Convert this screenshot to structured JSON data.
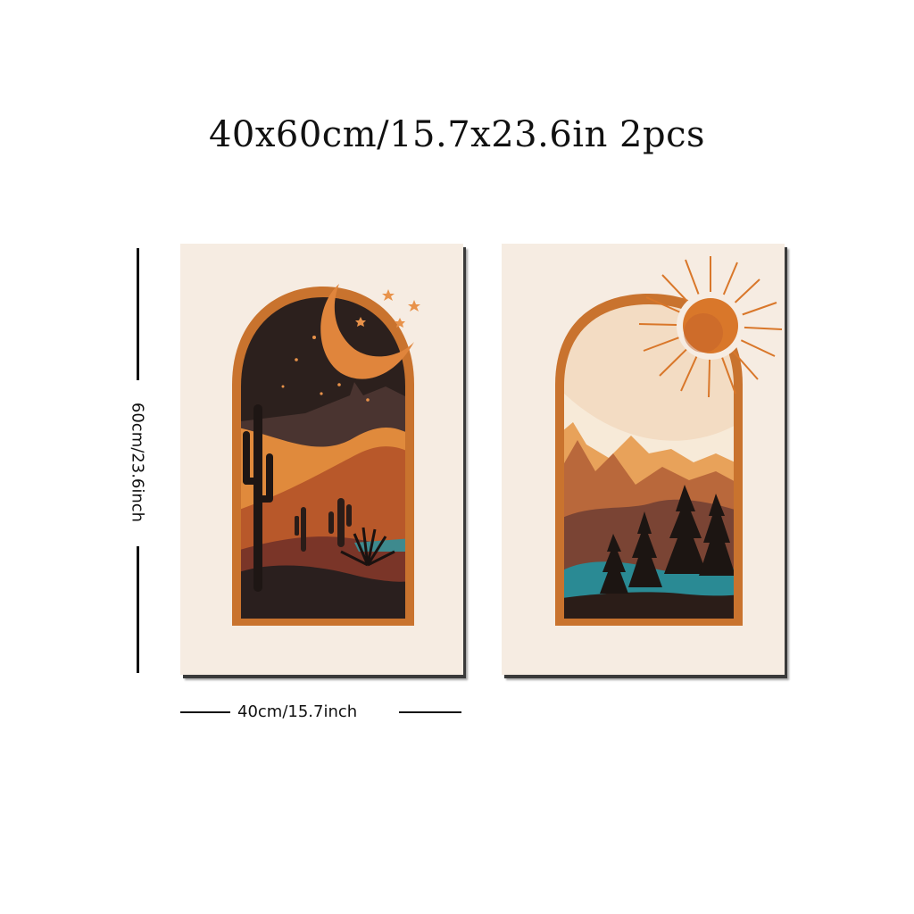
{
  "title": "40x60cm/15.7x23.6in 2pcs",
  "dimensions": {
    "height_label": "60cm/23.6inch",
    "width_label": "40cm/15.7inch"
  },
  "colors": {
    "paper": "#f6ece2",
    "frame_orange": "#c9732e",
    "night_sky": "#2c201d",
    "teal_water": "#2a8a94",
    "sun_orange": "#d9772a"
  },
  "posters": [
    {
      "name": "desert-night-print",
      "motifs": [
        "crescent-moon",
        "stars",
        "cactus",
        "mountains"
      ]
    },
    {
      "name": "mountain-sun-print",
      "motifs": [
        "sun",
        "mountains",
        "pine-trees",
        "lake"
      ]
    }
  ]
}
